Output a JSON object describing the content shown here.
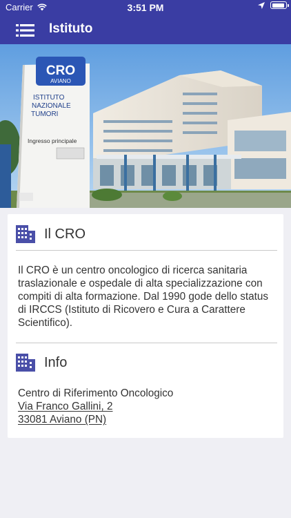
{
  "status_bar": {
    "carrier": "Carrier",
    "time": "3:51 PM"
  },
  "nav": {
    "title": "Istituto",
    "menu_icon": "list-menu-icon",
    "bar_color": "#3a3da3"
  },
  "hero": {
    "description_icon": "hospital-photo",
    "sign_logo_top": "CRO",
    "sign_logo_bottom": "AVIANO",
    "sign_line1": "ISTITUTO",
    "sign_line2": "NAZIONALE",
    "sign_line3": "TUMORI",
    "sign_entrance": "Ingresso principale"
  },
  "sections": {
    "cro": {
      "icon": "building-icon",
      "title": "Il CRO",
      "text": "Il CRO è un centro oncologico di ricerca sanitaria traslazionale e ospedale di alta specializzazione con compiti di alta formazione. Dal 1990 gode dello status di IRCCS (Istituto di Ricovero e Cura a Carattere Scientifico)."
    },
    "info": {
      "icon": "building-icon",
      "title": "Info",
      "name": "Centro di Riferimento Oncologico",
      "street": "Via Franco Gallini, 2",
      "city": "33081 Aviano (PN)"
    }
  },
  "colors": {
    "accent": "#3a3da3",
    "icon_color": "#4a4fa8",
    "background": "#efeff4"
  }
}
